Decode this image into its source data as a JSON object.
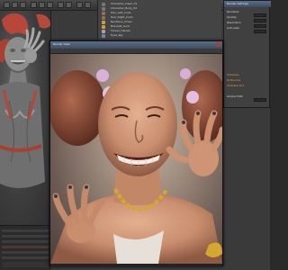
{
  "outliner": {
    "rows": [
      {
        "label": "Character_Head_01",
        "swatch": "#8a8a8a"
      },
      {
        "label": "Character_Body_02",
        "swatch": "#7a7a7a"
      },
      {
        "label": "Hair_Left_Curls",
        "swatch": "#9a6a5a"
      },
      {
        "label": "Hair_Right_Curls",
        "swatch": "#9a6a5a"
      },
      {
        "label": "Necklace_Chain",
        "swatch": "#c8a040"
      },
      {
        "label": "Bracelet_Gold",
        "swatch": "#c8a040"
      },
      {
        "label": "Flower_Hairpin",
        "swatch": "#c090c0"
      },
      {
        "label": "Eyes_Rig",
        "swatch": "#6a8aa0"
      },
      {
        "label": "Teeth_Upper",
        "swatch": "#d0d0d0"
      }
    ]
  },
  "render_dialog": {
    "title": "Render Settings",
    "rows": [
      {
        "label": "Renderer",
        "orange": false
      },
      {
        "label": "Quality",
        "orange": false
      },
      {
        "label": "Resolution",
        "orange": false
      },
      {
        "label": "Anti-alias",
        "orange": false
      },
      {
        "label": "Shadows",
        "orange": true
      },
      {
        "label": "GI Bounce",
        "orange": true
      },
      {
        "label": "Ambient Occ.",
        "orange": true
      },
      {
        "label": "Output Path",
        "orange": false
      }
    ]
  },
  "render_window": {
    "title": "Render View"
  },
  "colors": {
    "titlebar_accent": "#5b6e88",
    "skin": "#d9a588",
    "hair": "#8a4a3a",
    "gold": "#d4a830"
  },
  "icons": {
    "close": "close-icon"
  }
}
